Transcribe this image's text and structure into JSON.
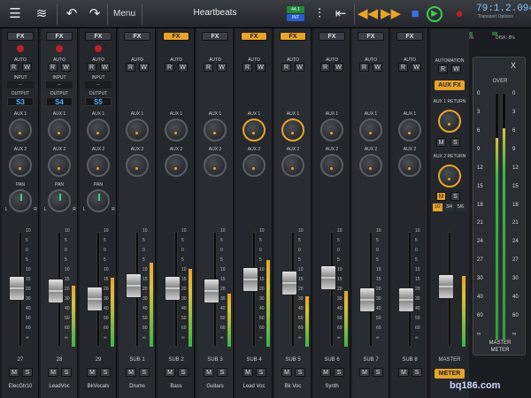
{
  "topbar": {
    "menu_label": "Menu",
    "title": "Heartbeats",
    "sample_rate": "44.1",
    "int_label": "INT",
    "time": "79:1.2.094",
    "transport_options": "Transport Options",
    "cpu_label": "CPU: 35%",
    "disk_label": "DISK: 8%"
  },
  "colors": {
    "accent": "#e8a32b",
    "record": "#c0202a",
    "play": "#3ad04a",
    "stop": "#3a6ee8",
    "meter_green": "#3bb54a",
    "value_blue": "#4fb6ff"
  },
  "labels": {
    "fx": "FX",
    "auto": "AUTO",
    "input": "INPUT",
    "output": "OUTPUT",
    "aux1": "AUX 1",
    "aux2": "AUX 2",
    "pan": "PAN",
    "r": "R",
    "w": "W",
    "m": "M",
    "s": "S",
    "l": "L",
    "rr": "R"
  },
  "channels": [
    {
      "num": "27",
      "name": "ElecGtr10",
      "fx_on": false,
      "rec": true,
      "input": "--",
      "output": "S3",
      "fader": 0.55,
      "meter": 0.0
    },
    {
      "num": "28",
      "name": "LeadVoc",
      "fx_on": false,
      "rec": true,
      "input": "--",
      "output": "S4",
      "fader": 0.53,
      "meter": 0.55
    },
    {
      "num": "29",
      "name": "BkVocals",
      "fx_on": false,
      "rec": true,
      "input": "--",
      "output": "S5",
      "fader": 0.45,
      "meter": 0.62
    },
    {
      "num": "SUB 1",
      "name": "Drums",
      "fx_on": false,
      "fader": 0.58,
      "meter": 0.75
    },
    {
      "num": "SUB 2",
      "name": "Bass",
      "fx_on": true,
      "fader": 0.55,
      "meter": 0.7
    },
    {
      "num": "SUB 3",
      "name": "Guitars",
      "fx_on": false,
      "fader": 0.53,
      "meter": 0.48
    },
    {
      "num": "SUB 4",
      "name": "Lead Voc",
      "fx_on": true,
      "fader": 0.64,
      "meter": 0.78
    },
    {
      "num": "SUB 5",
      "name": "Bk Voc",
      "fx_on": true,
      "fader": 0.61,
      "meter": 0.45
    },
    {
      "num": "SUB 6",
      "name": "Synth",
      "fx_on": false,
      "fader": 0.66,
      "meter": 0.5
    },
    {
      "num": "SUB 7",
      "name": "",
      "fx_on": false,
      "fader": 0.44,
      "meter": 0.0
    },
    {
      "num": "SUB 8",
      "name": "",
      "fx_on": false,
      "fader": 0.44,
      "meter": 0.0
    }
  ],
  "fader_scale": [
    "10",
    "5",
    "0",
    "5",
    "10",
    "15",
    "20",
    "30",
    "40",
    "50",
    "60",
    "∞"
  ],
  "bus": {
    "automation": "AUTOMATION",
    "aux_fx": "AUX FX",
    "aux1_return": "AUX 1 RETURN",
    "aux2_return": "AUX 2 RETURN",
    "tabs": [
      "1/2",
      "3/4",
      "5/6"
    ],
    "name": "MASTER",
    "meter_btn": "METER"
  },
  "master_meter": {
    "close": "X",
    "over": "OVER",
    "scale": [
      "0",
      "3",
      "6",
      "9",
      "12",
      "15",
      "18",
      "21",
      "24",
      "27",
      "30",
      "40",
      "60",
      "∞"
    ],
    "level_left": 0.82,
    "level_right": 0.86,
    "label_line1": "MASTER",
    "label_line2": "METER"
  },
  "watermark": "bq186.com"
}
